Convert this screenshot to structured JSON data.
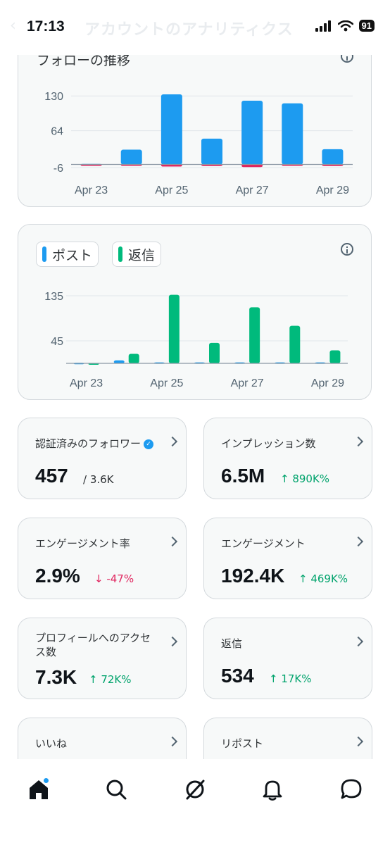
{
  "status_bar": {
    "time": "17:13",
    "battery": "91"
  },
  "header": {
    "title": "アカウントのアナリティクス"
  },
  "follows_chart": {
    "title": "フォローの推移"
  },
  "posts_chart": {
    "legend": [
      "ポスト",
      "返信"
    ]
  },
  "chart_data": [
    {
      "type": "bar",
      "title": "フォローの推移",
      "categories": [
        "Apr 23",
        "Apr 24",
        "Apr 25",
        "Apr 26",
        "Apr 27",
        "Apr 28",
        "Apr 29"
      ],
      "x_tick_labels": [
        "Apr 23",
        "Apr 25",
        "Apr 27",
        "Apr 29"
      ],
      "y_tick_labels": [
        "130",
        "64",
        "-6"
      ],
      "ylim": [
        -6,
        133
      ],
      "grid": true,
      "series": [
        {
          "values": [
            1,
            28,
            133,
            49,
            121,
            116,
            29
          ],
          "color": "#1d9bf0"
        },
        {
          "values": [
            -1,
            -2,
            -4,
            -3,
            -5,
            -1,
            -3
          ],
          "color": "#e0245e"
        }
      ]
    },
    {
      "type": "bar",
      "categories": [
        "Apr 23",
        "Apr 24",
        "Apr 25",
        "Apr 26",
        "Apr 27",
        "Apr 28",
        "Apr 29"
      ],
      "x_tick_labels": [
        "Apr 23",
        "Apr 25",
        "Apr 27",
        "Apr 29"
      ],
      "y_tick_labels": [
        "135",
        "45"
      ],
      "ylim": [
        0,
        135
      ],
      "grid": true,
      "legend": "top-left",
      "series": [
        {
          "name": "ポスト",
          "values": [
            1,
            6,
            2,
            2,
            2,
            2,
            2
          ],
          "color": "#1d9bf0"
        },
        {
          "name": "返信",
          "values": [
            0,
            19,
            137,
            41,
            112,
            75,
            26
          ],
          "color": "#00ba7c"
        }
      ]
    }
  ],
  "stats": [
    {
      "label": "認証済みのフォロワー",
      "value": "457",
      "sub": "/ 3.6K"
    },
    {
      "label": "インプレッション数",
      "value": "6.5M",
      "delta": "↑ 890K%"
    },
    {
      "label": "エンゲージメント率",
      "value": "2.9%",
      "delta": "↓ -47%"
    },
    {
      "label": "エンゲージメント",
      "value": "192.4K",
      "delta": "↑ 469K%"
    },
    {
      "label": "プロフィールへのアクセス数",
      "value": "7.3K",
      "delta": "↑ 72K%"
    },
    {
      "label": "返信",
      "value": "534",
      "delta": "↑ 17K%"
    },
    {
      "label": "いいね"
    },
    {
      "label": "リポスト"
    }
  ],
  "tabbar": {
    "icons": [
      "home-icon",
      "search-icon",
      "grok-icon",
      "bell-icon",
      "messages-icon"
    ]
  }
}
